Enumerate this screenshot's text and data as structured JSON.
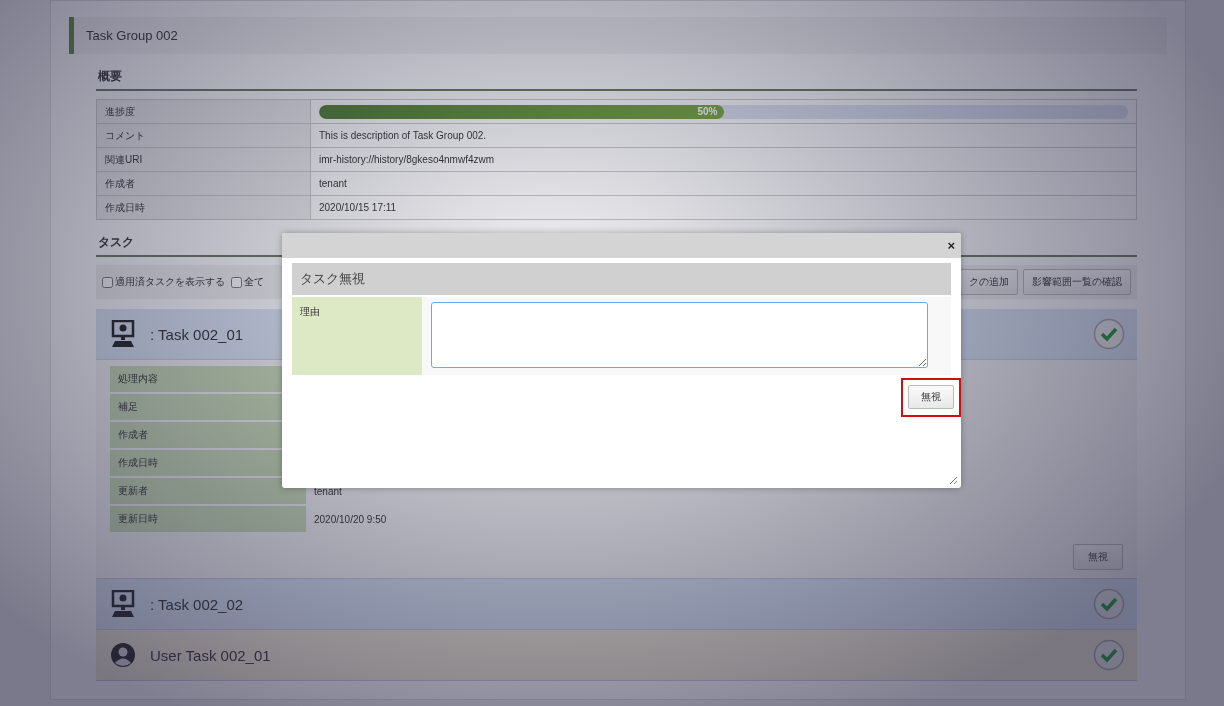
{
  "page": {
    "title": "Task Group 002"
  },
  "overview": {
    "heading": "概要",
    "rows": [
      {
        "kind": "progress",
        "label": "進捗度",
        "level": 0.5,
        "reading": "50%"
      },
      {
        "kind": "text",
        "label": "コメント",
        "value": "This is description of Task Group 002."
      },
      {
        "kind": "text",
        "label": "関連URI",
        "value": "imr-history://history/8gkeso4nmwf4zwm"
      },
      {
        "kind": "text",
        "label": "作成者",
        "value": "tenant"
      },
      {
        "kind": "text",
        "label": "作成日時",
        "value": "2020/10/15 17:11"
      }
    ]
  },
  "tasks": {
    "heading": "タスク",
    "filters": [
      {
        "label": "適用済タスクを表示する",
        "checked": false
      },
      {
        "label": "全て",
        "checked": false
      }
    ],
    "buttons": [
      "クの追加",
      "影響範囲一覧の確認"
    ],
    "items": [
      {
        "kind": "system",
        "name": ": Task 002_01",
        "done": true,
        "expanded": true,
        "details": [
          {
            "label": "処理内容"
          },
          {
            "label": "補足"
          },
          {
            "label": "作成者"
          },
          {
            "label": "作成日時"
          },
          {
            "label": "更新者",
            "value": "tenant"
          },
          {
            "label": "更新日時",
            "value": "2020/10/20 9:50"
          }
        ],
        "action": "無視"
      },
      {
        "kind": "system",
        "name": ": Task 002_02",
        "done": true,
        "expanded": false
      },
      {
        "kind": "user",
        "name": "User Task 002_01",
        "done": true,
        "expanded": false
      }
    ]
  },
  "dialog": {
    "close": "×",
    "heading": "タスク無視",
    "field_label": "理由",
    "button": {
      "label": "無視",
      "highlighted": true
    }
  }
}
